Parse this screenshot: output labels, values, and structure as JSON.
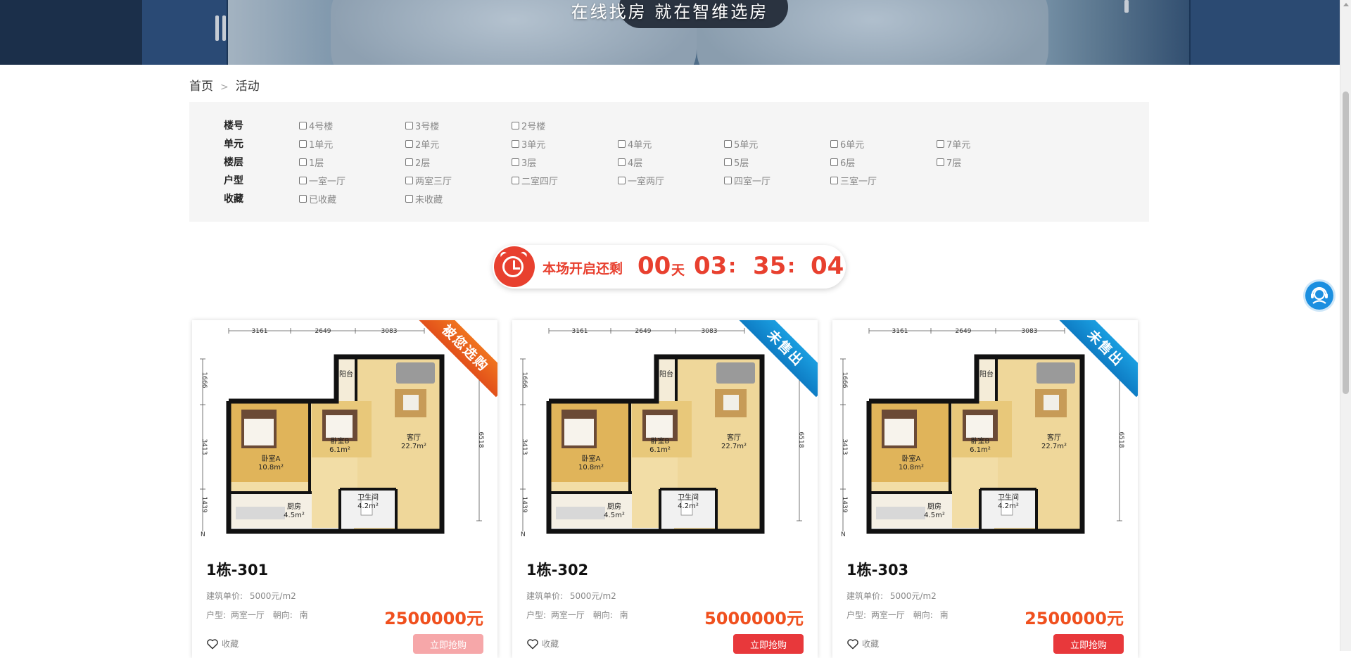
{
  "banner": {
    "title": "在线找房 就在智维选房"
  },
  "breadcrumb": {
    "home": "首页",
    "separator": ">",
    "current": "活动"
  },
  "filters": [
    {
      "label": "楼号",
      "options": [
        "4号楼",
        "3号楼",
        "2号楼"
      ]
    },
    {
      "label": "单元",
      "options": [
        "1单元",
        "2单元",
        "3单元",
        "4单元",
        "5单元",
        "6单元",
        "7单元"
      ]
    },
    {
      "label": "楼层",
      "options": [
        "1层",
        "2层",
        "3层",
        "4层",
        "5层",
        "6层",
        "7层"
      ]
    },
    {
      "label": "户型",
      "options": [
        "一室一厅",
        "两室三厅",
        "二室四厅",
        "一室两厅",
        "四室一厅",
        "三室一厅"
      ]
    },
    {
      "label": "收藏",
      "options": [
        "已收藏",
        "未收藏"
      ]
    }
  ],
  "countdown": {
    "label": "本场开启还剩",
    "days": "00",
    "day_unit": "天",
    "hours": "03",
    "minutes": "35",
    "seconds": "04",
    "colon": ":"
  },
  "floorplan": {
    "dims_top": [
      "3161",
      "2649",
      "3083"
    ],
    "dims_left": [
      "1666",
      "3413",
      "1439"
    ],
    "dim_right": "6518",
    "north": "N",
    "rooms": [
      {
        "name": "卧室A",
        "area": "10.8m²"
      },
      {
        "name": "卧室B",
        "area": "6.1m²"
      },
      {
        "name": "客厅",
        "area": "22.7m²"
      },
      {
        "name": "卫生间",
        "area": "4.2m²"
      },
      {
        "name": "厨房",
        "area": "4.5m²"
      },
      {
        "name": "阳台",
        "area": ""
      }
    ]
  },
  "cards": [
    {
      "ribbon": "被您选购",
      "ribbon_color": "#e8551b",
      "title": "1栋-301",
      "unit_price_label": "建筑单价:",
      "unit_price": "5000元/m2",
      "type_label": "户型:",
      "type": "两室一厅",
      "orient_label": "朝向:",
      "orient": "南",
      "price": "2500000元",
      "fav_label": "收藏",
      "buy_label": "立即抢购",
      "buy_disabled": true
    },
    {
      "ribbon": "未售出",
      "ribbon_color": "#1287cf",
      "title": "1栋-302",
      "unit_price_label": "建筑单价:",
      "unit_price": "5000元/m2",
      "type_label": "户型:",
      "type": "两室一厅",
      "orient_label": "朝向:",
      "orient": "南",
      "price": "5000000元",
      "fav_label": "收藏",
      "buy_label": "立即抢购",
      "buy_disabled": false
    },
    {
      "ribbon": "未售出",
      "ribbon_color": "#1287cf",
      "title": "1栋-303",
      "unit_price_label": "建筑单价:",
      "unit_price": "5000元/m2",
      "type_label": "户型:",
      "type": "两室一厅",
      "orient_label": "朝向:",
      "orient": "南",
      "price": "2500000元",
      "fav_label": "收藏",
      "buy_label": "立即抢购",
      "buy_disabled": false
    }
  ],
  "colors": {
    "accent_red": "#e8383b",
    "price_orange": "#f0501e",
    "countdown_red": "#e8402f",
    "sold_blue": "#1287cf",
    "service_blue": "#1b8fe0"
  },
  "icons": {
    "service": "customer-service-icon",
    "favorite": "heart-outline-icon",
    "countdown": "alarm-clock-icon"
  }
}
